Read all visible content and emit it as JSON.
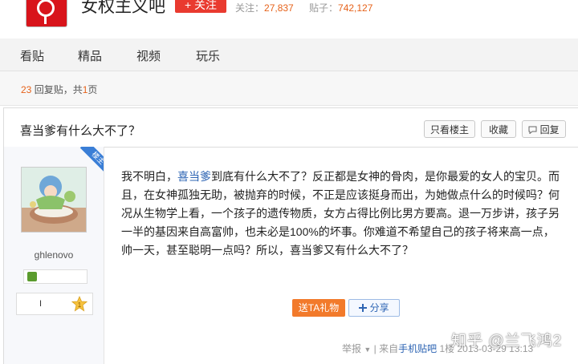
{
  "forum": {
    "title": "女权主义吧",
    "follow_label": "+ 关注",
    "followers_label": "关注：",
    "followers_value": "27,837",
    "posts_label": "贴子：",
    "posts_value": "742,127"
  },
  "nav": {
    "items": [
      "看贴",
      "精品",
      "视频",
      "玩乐"
    ]
  },
  "pagination": {
    "reply_count": "23",
    "reply_text": "回复贴，共",
    "page_count": "1",
    "page_text": "页"
  },
  "thread": {
    "title": "喜当爹有什么大不了？",
    "only_owner_label": "只看楼主",
    "favorite_label": "收藏",
    "reply_label": "回复"
  },
  "post": {
    "owner_tag": "楼主",
    "username": "ghlenovo",
    "level": "I",
    "content_prefix": "我不明白，",
    "content_link": "喜当爹",
    "content_rest": "到底有什么大不了？反正都是女神的骨肉，是你最爱的女人的宝贝。而且，在女神孤独无助，被抛弃的时候，不正是应该挺身而出，为她做点什么的时候吗？何况从生物学上看，一个孩子的遗传物质，女方占得比例比男方要高。退一万步讲，孩子另一半的基因来自高富帅，也未必是100%的坏事。你难道不希望自己的孩子将来高一点，帅一天，甚至聪明一点吗？所以，喜当爹又有什么大不了？",
    "gift_label": "送TA礼物",
    "share_label": "分享",
    "report_label": "举报",
    "source_prefix": "| 来自",
    "source_link": "手机贴吧",
    "floor": "1楼",
    "datetime": "2013-03-29 13:13"
  },
  "watermark": "知乎 @兰飞鸿2",
  "colors": {
    "brand_red": "#d8141b",
    "accent_orange": "#e6621a",
    "link_blue": "#2d64b3",
    "follow_red": "#e93a2f"
  },
  "icons": [
    "forum-logo-icon",
    "owner-corner-badge",
    "user-badge-icon",
    "level-star-icon",
    "reply-icon",
    "share-plus-icon",
    "dropdown-arrow-icon"
  ]
}
